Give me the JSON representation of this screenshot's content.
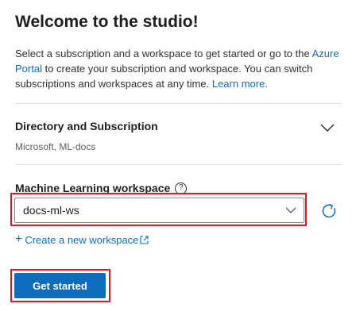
{
  "header": {
    "title": "Welcome to the studio!"
  },
  "intro": {
    "text_1": "Select a subscription and a workspace to get started or go to the ",
    "azure_portal_link": "Azure Portal",
    "text_2": " to create your subscription and workspace. You can switch subscriptions and workspaces at any time. ",
    "learn_more_link": "Learn more."
  },
  "directory": {
    "title": "Directory and Subscription",
    "value": "Microsoft, ML-docs",
    "toggle_icon": "chevron-down-icon"
  },
  "workspace": {
    "label": "Machine Learning workspace",
    "info_icon": "info-icon",
    "info_glyph": "?",
    "selected": "docs-ml-ws",
    "refresh_icon": "refresh-icon"
  },
  "create": {
    "plus": "+",
    "label": "Create a new workspace"
  },
  "actions": {
    "get_started": "Get started"
  },
  "colors": {
    "accent": "#0f6cbd",
    "highlight": "#e81123",
    "divider": "#e1dfdd"
  }
}
